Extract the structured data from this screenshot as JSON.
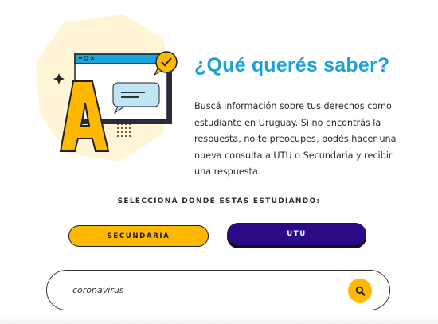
{
  "hero": {
    "title": "¿Qué querés saber?",
    "intro": "Buscá información sobre tus derechos como estudiante en Uruguay. Si no encontrás la respuesta, no te preocupes, podés hacer una nueva consulta a UTU o Secundaria y recibir una respuesta.",
    "illustration_letter": "A",
    "illustration_icons": [
      "letter-a-illustration",
      "browser-window-illustration",
      "chat-bubble-icon",
      "check-badge-icon",
      "sparkle-icon"
    ]
  },
  "selector": {
    "label": "SELECCIONÁ DONDE ESTÁS ESTUDIANDO:",
    "options": [
      {
        "label": "SECUNDARIA",
        "selected": false
      },
      {
        "label": "UTU",
        "selected": true
      }
    ]
  },
  "search": {
    "value": "coronavirus",
    "placeholder": "",
    "icon": "search-icon"
  },
  "colors": {
    "accent_blue": "#1aa3d9",
    "accent_yellow": "#ffb800",
    "accent_purple": "#2a0a86",
    "blob": "#fff5d6",
    "ink": "#1b1b3a"
  }
}
